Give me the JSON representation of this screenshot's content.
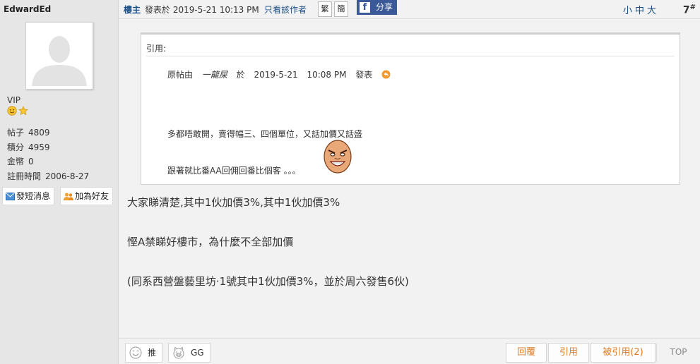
{
  "user": {
    "name": "EdwardEd",
    "rank": "VIP",
    "stats": [
      {
        "label": "帖子",
        "value": "4809"
      },
      {
        "label": "積分",
        "value": "4959"
      },
      {
        "label": "金幣",
        "value": "0"
      },
      {
        "label": "註冊時間",
        "value": "2006-8-27"
      }
    ],
    "message_button": "發短消息",
    "friend_button": "加為好友"
  },
  "header": {
    "author_tag": "樓主",
    "posted_text": "發表於  2019-5-21 10:13 PM",
    "only_author": "只看該作者",
    "trad_button": "繁",
    "simp_button": "簡",
    "share_button": "分享",
    "font_sizes": "小中大",
    "floor_number": "7",
    "floor_suffix": "#"
  },
  "quote": {
    "label": "引用:",
    "origin_prefix": "原帖由",
    "origin_author": "一龍屎",
    "origin_at": "於",
    "origin_date": "2019-5-21",
    "origin_time": "10:08  PM",
    "origin_suffix": "發表",
    "line1": "多都唔敢開，賣得幅三、四個單位，又話加價又話盛",
    "line2": "跟著就比番AA回佣回番比個客 。。。"
  },
  "body": [
    "大家睇清楚,其中1伙加價3%,其中1伙加價3%",
    "慳A禁睇好樓市，為什麼不全部加價",
    "(同系西營盤藝里坊·1號其中1伙加價3%，並於周六發售6伙)"
  ],
  "footer": {
    "push": "推",
    "gg": "GG",
    "reply": "回覆",
    "quote": "引用",
    "quoted_by": "被引用(2)",
    "top": "TOP"
  }
}
